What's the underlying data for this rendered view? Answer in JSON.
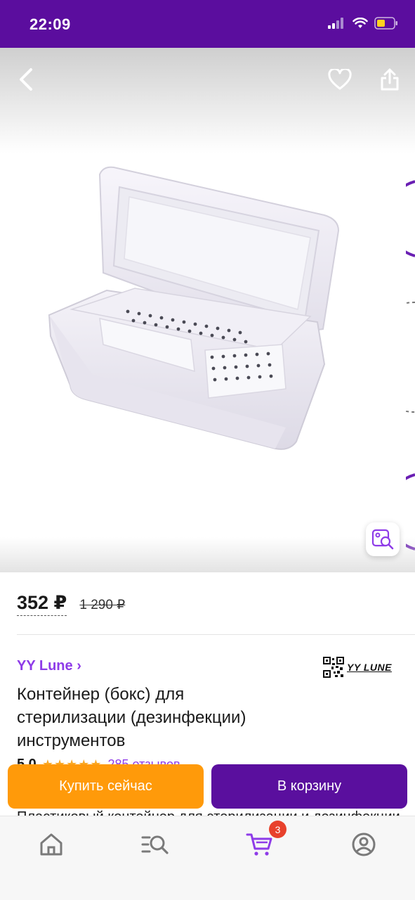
{
  "status_bar": {
    "time": "22:09"
  },
  "gallery": {
    "back_icon": "chevron-left-icon",
    "favorite_icon": "heart-icon",
    "share_icon": "share-icon",
    "visual_search_icon": "image-search-icon",
    "background_color": "#ffffff"
  },
  "price": {
    "current": "352 ₽",
    "old": "1 290 ₽"
  },
  "brand": {
    "name": "YY Lune ›",
    "logo_text": "YY LUNE"
  },
  "product": {
    "title_line1": "Контейнер (бокс) для",
    "title_line2": "стерилизации (дезинфекции)",
    "title_line3": "инструментов"
  },
  "rating": {
    "value": "5,0",
    "stars": "★★★★★",
    "reviews": "285 отзывов"
  },
  "description_peek": "Пластиковый контейнер для стерилизации и дезинфекции",
  "actions": {
    "buy_now": "Купить сейчас",
    "add_to_cart": "В корзину"
  },
  "tab_bar": {
    "home_icon": "home-icon",
    "catalog_icon": "catalog-search-icon",
    "cart_icon": "cart-icon",
    "cart_count": "3",
    "profile_icon": "profile-icon"
  },
  "colors": {
    "brand_purple": "#5b0d9e",
    "accent_purple": "#8e3be8",
    "buy_orange": "#ff9a0a",
    "badge_red": "#e8412c"
  }
}
